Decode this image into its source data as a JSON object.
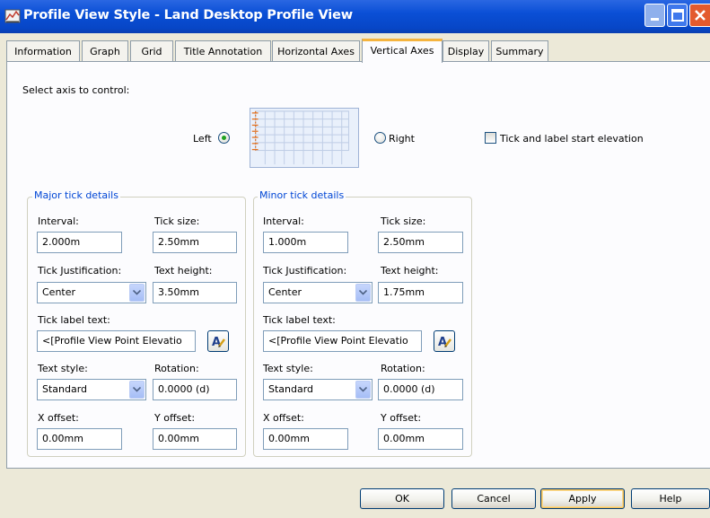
{
  "window": {
    "title": "Profile View Style - Land Desktop Profile View",
    "icon": "profile-view-style-icon"
  },
  "tabs": [
    "Information",
    "Graph",
    "Grid",
    "Title Annotation",
    "Horizontal Axes",
    "Vertical Axes",
    "Display",
    "Summary"
  ],
  "active_tab": "Vertical Axes",
  "axis_select": {
    "prompt": "Select axis to control:",
    "left_label": "Left",
    "right_label": "Right",
    "selected": "Left",
    "tick_start_label": "Tick and label start elevation",
    "tick_start_checked": false
  },
  "major": {
    "title": "Major tick details",
    "interval_label": "Interval:",
    "interval": "2.000m",
    "tick_size_label": "Tick size:",
    "tick_size": "2.50mm",
    "justification_label": "Tick Justification:",
    "justification": "Center",
    "text_height_label": "Text height:",
    "text_height": "3.50mm",
    "label_text_label": "Tick label text:",
    "label_text": "<[Profile View Point Elevatio",
    "text_style_label": "Text style:",
    "text_style": "Standard",
    "rotation_label": "Rotation:",
    "rotation": "0.0000 (d)",
    "x_offset_label": "X offset:",
    "x_offset": "0.00mm",
    "y_offset_label": "Y offset:",
    "y_offset": "0.00mm"
  },
  "minor": {
    "title": "Minor tick details",
    "interval_label": "Interval:",
    "interval": "1.000m",
    "tick_size_label": "Tick size:",
    "tick_size": "2.50mm",
    "justification_label": "Tick Justification:",
    "justification": "Center",
    "text_height_label": "Text height:",
    "text_height": "1.75mm",
    "label_text_label": "Tick label text:",
    "label_text": "<[Profile View Point Elevatio",
    "text_style_label": "Text style:",
    "text_style": "Standard",
    "rotation_label": "Rotation:",
    "rotation": "0.0000 (d)",
    "x_offset_label": "X offset:",
    "x_offset": "0.00mm",
    "y_offset_label": "Y offset:",
    "y_offset": "0.00mm"
  },
  "buttons": {
    "ok": "OK",
    "cancel": "Cancel",
    "apply": "Apply",
    "help": "Help"
  },
  "colors": {
    "titlebar": "#0a4fd6",
    "active_tab_accent": "#f5b43e",
    "group_title": "#0046d5",
    "radio_dot": "#21a121"
  }
}
